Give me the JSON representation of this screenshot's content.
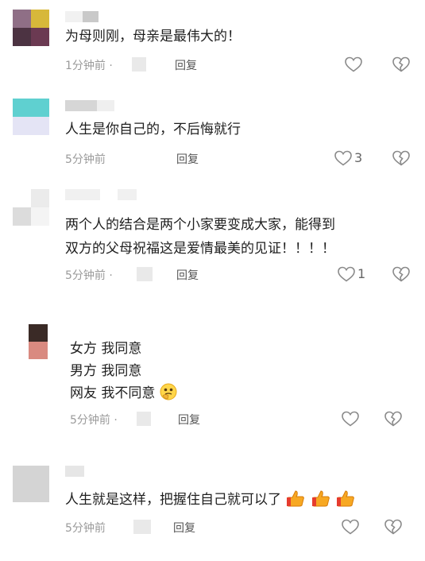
{
  "comments": [
    {
      "text_lines": [
        "为母则刚，母亲是最伟大的！"
      ],
      "time": "1分钟前 ·",
      "reply": "回复",
      "like_count": ""
    },
    {
      "text_lines": [
        "人生是你自己的，不后悔就行"
      ],
      "time": "5分钟前",
      "reply": "回复",
      "like_count": "3"
    },
    {
      "text_lines": [
        "两个人的结合是两个小家要变成大家，能得到",
        "双方的父母祝福这是爱情最美的见证！！！！"
      ],
      "time": "5分钟前 ·",
      "reply": "回复",
      "like_count": "1"
    },
    {
      "text_lines": [
        "女方 我同意",
        "男方 我同意",
        "网友 我不同意"
      ],
      "time": "5分钟前 ·",
      "reply": "回复",
      "like_count": ""
    },
    {
      "text_lines": [
        "人生就是这样，把握住自己就可以了"
      ],
      "time": "5分钟前",
      "reply": "回复",
      "like_count": ""
    }
  ],
  "icons": {
    "like": "heart-outline-icon",
    "dislike": "broken-heart-outline-icon",
    "emoji_thinking": "thinking-face-emoji",
    "emoji_thumbs": "thumbs-up-emoji"
  },
  "colors": {
    "text": "#1f1f1f",
    "meta": "#9a9a9a",
    "reply": "#555555",
    "icon": "#8a8a8a"
  }
}
